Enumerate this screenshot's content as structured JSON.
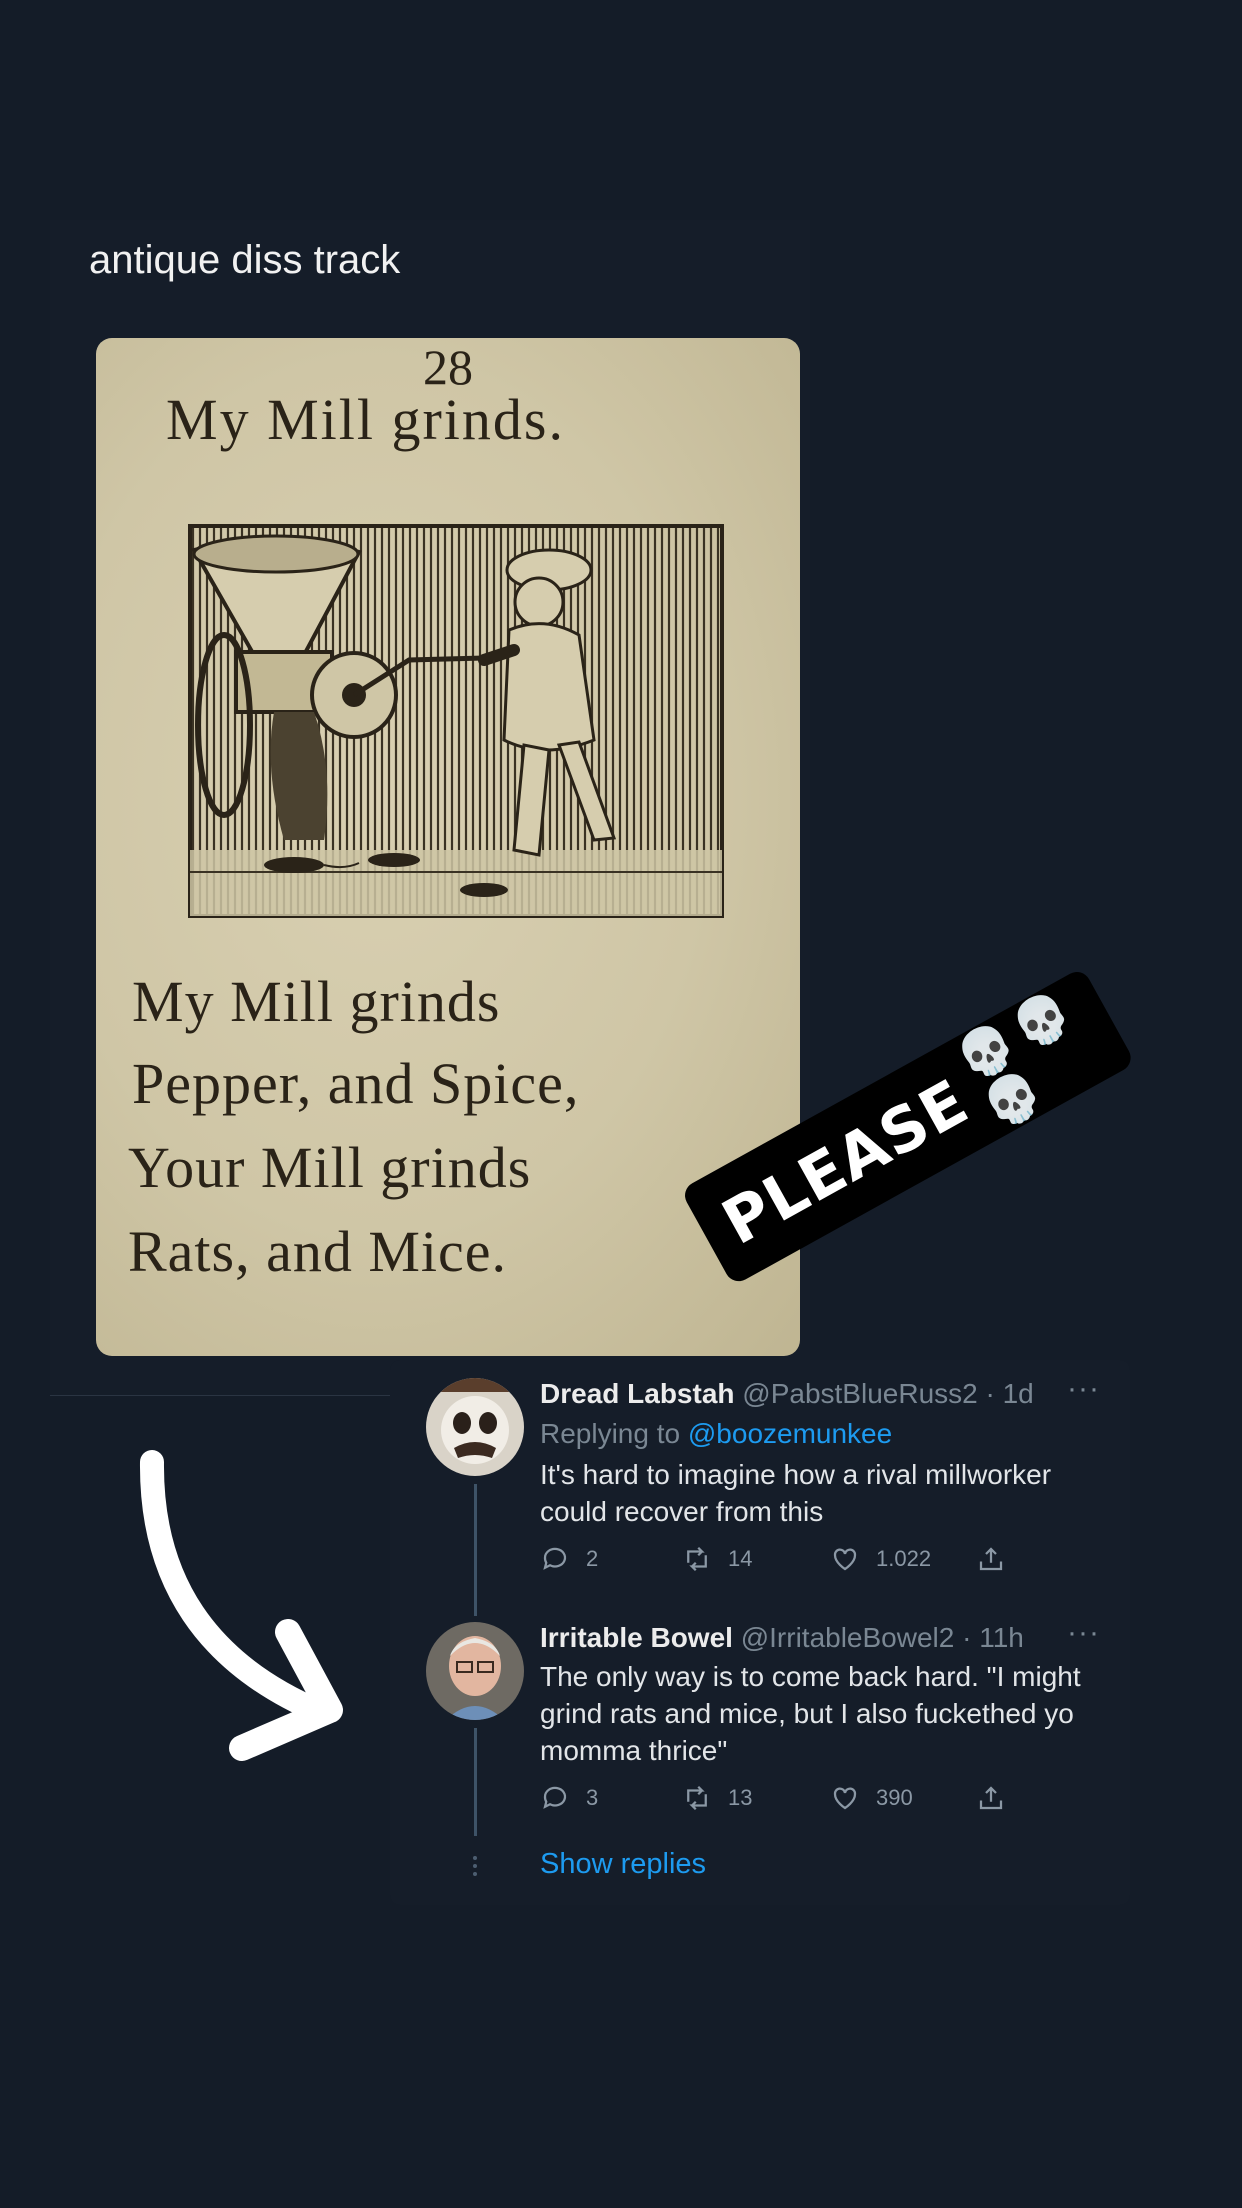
{
  "post": {
    "caption": "antique diss track"
  },
  "page_image": {
    "page_number": "28",
    "title": "My  Mill  grinds.",
    "verse": [
      "My   Mill   grinds",
      "Pepper, and  Spice,",
      "Your  Mill   grinds",
      "Rats, and  Mice."
    ]
  },
  "sticker": {
    "word": "PLEASE",
    "emoji": "💀💀💀"
  },
  "tweets": [
    {
      "name": "Dread Labstah",
      "handle": "@PabstBlueRuss2",
      "time": "· 1d",
      "more": "···",
      "replying_label": "Replying to",
      "replying_handle": "@boozemunkee",
      "text": "It's hard to imagine how a rival millworker could recover from this",
      "replies": "2",
      "retweets": "14",
      "likes": "1.022"
    },
    {
      "name": "Irritable Bowel",
      "handle": "@IrritableBowel2",
      "time": "· 11h",
      "more": "···",
      "text": "The only way is to come back hard. \"I might grind rats and mice, but I also fuckethed yo momma thrice\"",
      "replies": "3",
      "retweets": "13",
      "likes": "390"
    }
  ],
  "show_replies": "Show replies",
  "colors": {
    "background": "#141c28",
    "link": "#1d9bf0",
    "muted": "#7a8793"
  },
  "icons": [
    "reply-icon",
    "retweet-icon",
    "like-icon",
    "share-icon",
    "more-icon",
    "hand-drawn-arrow",
    "skull-emoji"
  ]
}
